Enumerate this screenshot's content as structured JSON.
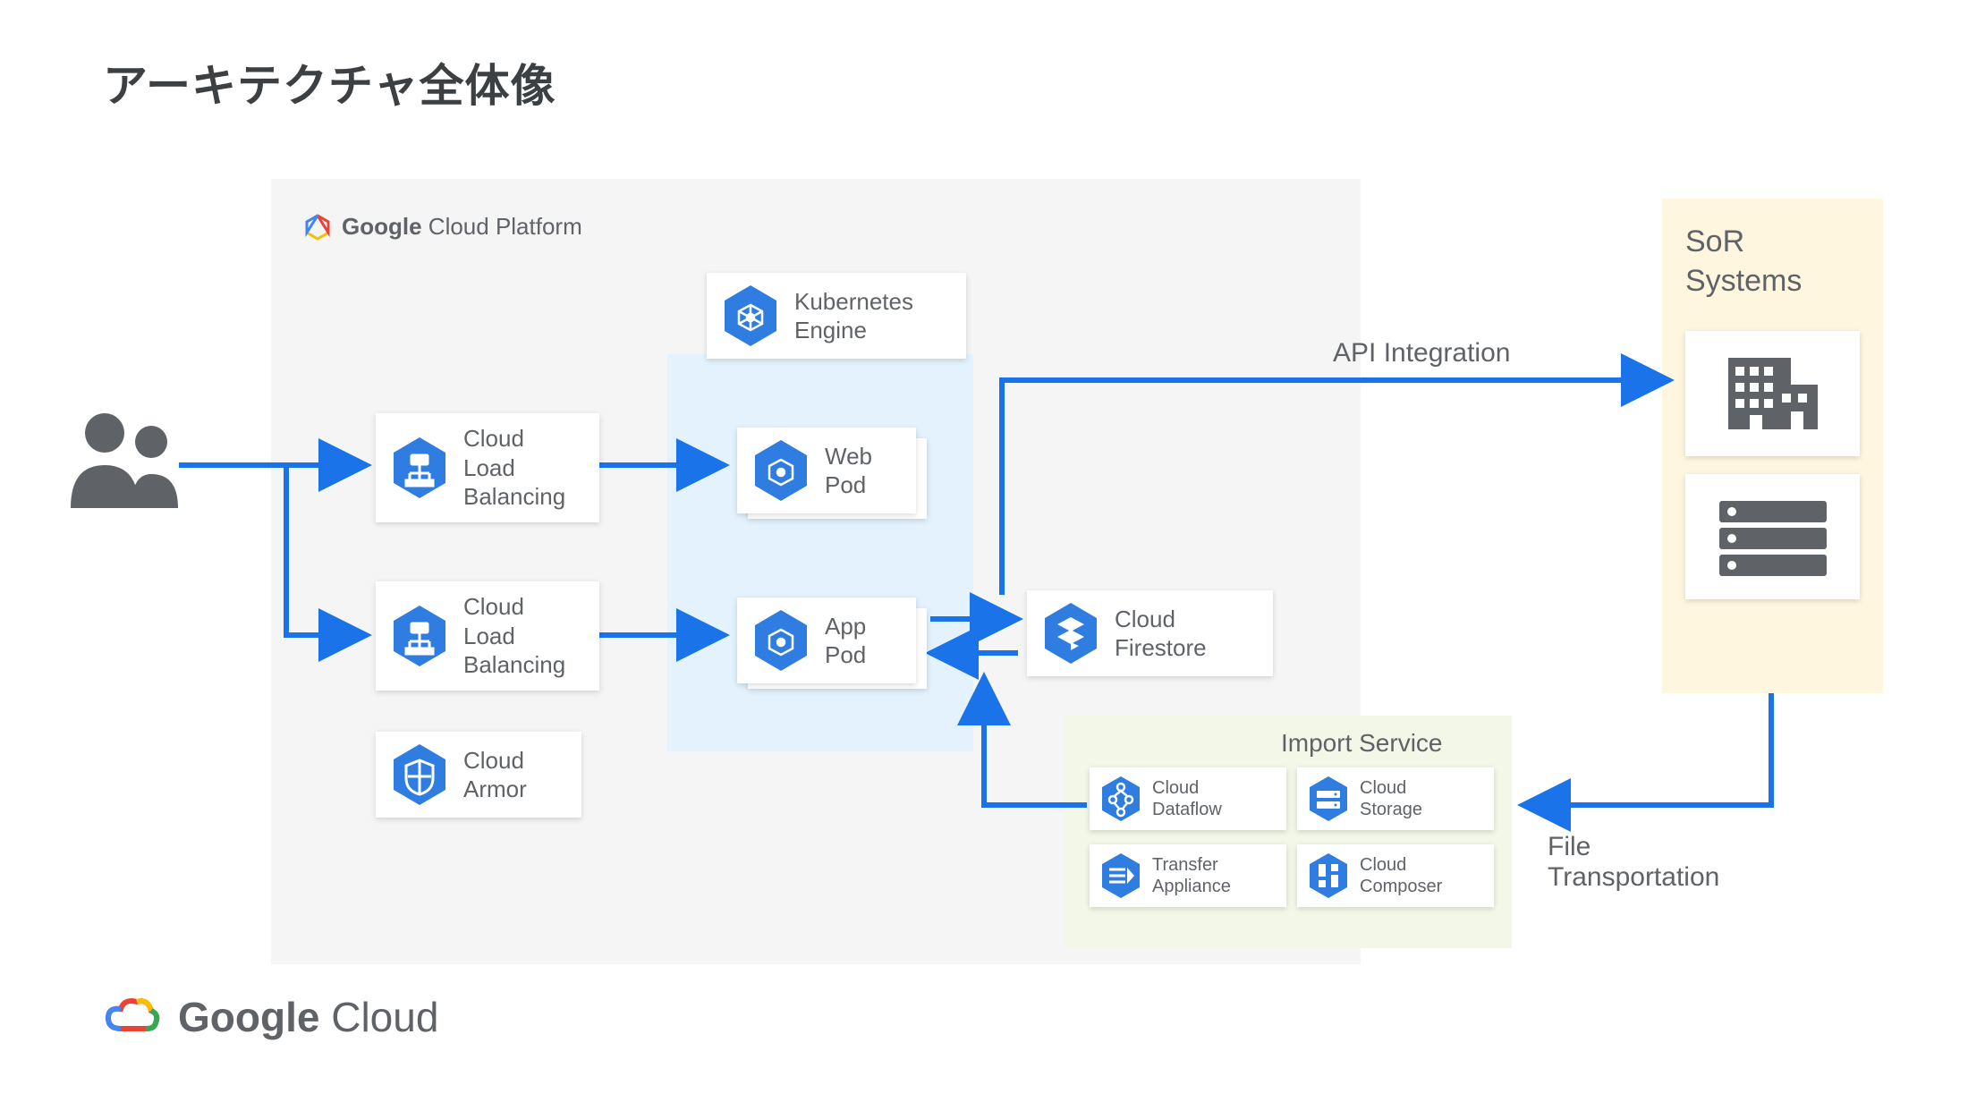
{
  "title": "アーキテクチャ全体像",
  "platform_label_bold": "Google",
  "platform_label_rest": " Cloud Platform",
  "footer_bold": "Google",
  "footer_rest": " Cloud",
  "sor_title": "SoR\nSystems",
  "import_title": "Import Service",
  "edge_api": "API Integration",
  "edge_file": "File\nTransportation",
  "nodes": {
    "users": "Users",
    "clb1": "Cloud\nLoad\nBalancing",
    "clb2": "Cloud\nLoad\nBalancing",
    "armor": "Cloud\nArmor",
    "gke": "Kubernetes\nEngine",
    "webpod": "Web\nPod",
    "apppod": "App\nPod",
    "firestore": "Cloud\nFirestore",
    "dataflow": "Cloud\nDataflow",
    "storage": "Cloud\nStorage",
    "transfer": "Transfer\nAppliance",
    "composer": "Cloud\nComposer"
  },
  "colors": {
    "arrow": "#1a73e8",
    "hex": "#2f7de1",
    "grey": "#5f6368"
  }
}
